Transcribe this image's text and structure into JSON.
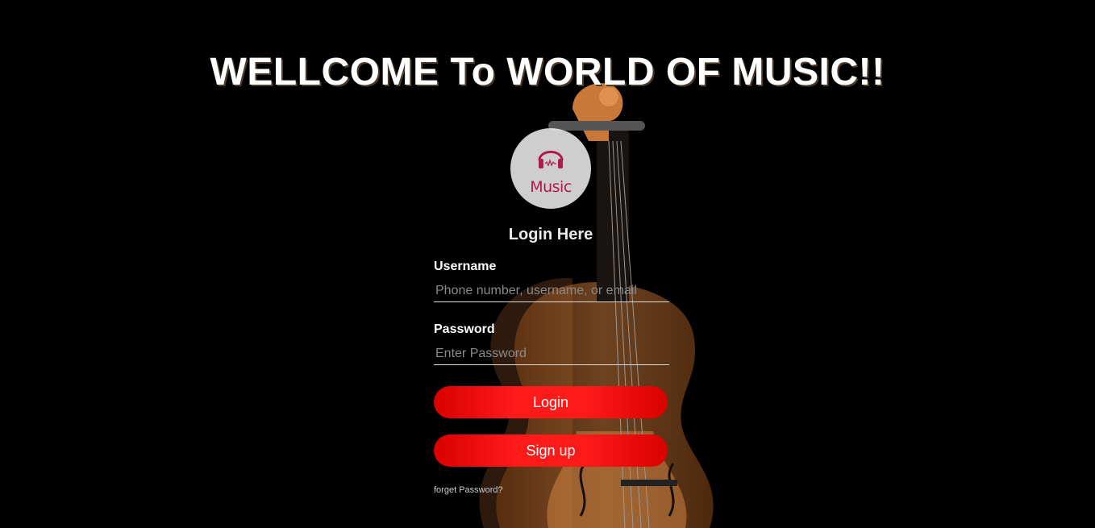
{
  "header": {
    "title": "WELLCOME To WORLD OF MUSIC!!"
  },
  "logo": {
    "text": "Music",
    "icon": "headphones-icon"
  },
  "form": {
    "title": "Login Here",
    "username": {
      "label": "Username",
      "placeholder": "Phone number, username, or email",
      "value": ""
    },
    "password": {
      "label": "Password",
      "placeholder": "Enter Password",
      "value": ""
    },
    "login_label": "Login",
    "signup_label": "Sign up",
    "forget_label": "forget Password?"
  },
  "colors": {
    "background": "#000000",
    "button": "#ff1a1a",
    "logo_accent": "#b01c4a"
  }
}
